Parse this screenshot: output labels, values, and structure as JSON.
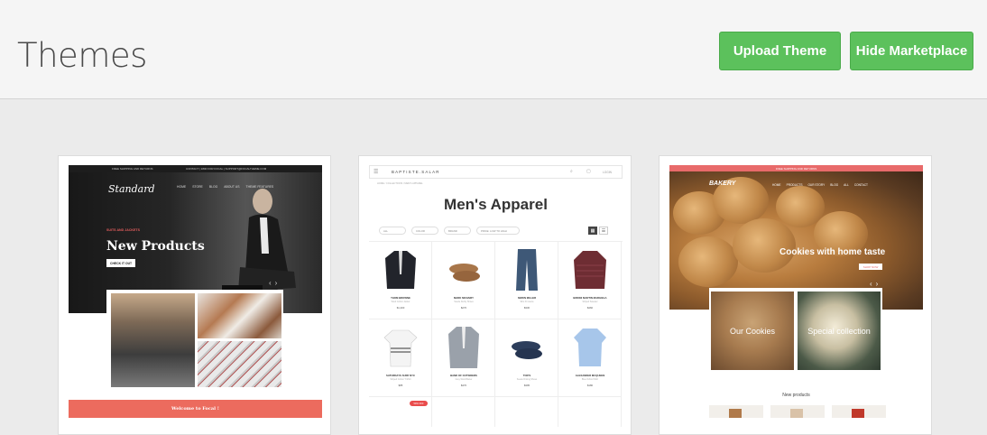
{
  "header": {
    "title": "Themes",
    "upload_button": "Upload Theme",
    "hide_button": "Hide Marketplace",
    "accent": "#5cc15c"
  },
  "themes": [
    {
      "name": "Focal",
      "topbar_left": "FREE SHIPPING AND RETURNS",
      "topbar_right": "CONTACT  |  1800 FOR FOCAL  |  SUPPORT@FOCALTHEME.COM",
      "logo": "Standard",
      "nav": [
        "HOME",
        "STORE",
        "BLOG",
        "ABOUT US",
        "THEME FEATURES"
      ],
      "hero_subtitle": "SUITS AND JACKETS",
      "hero_title": "New Products",
      "hero_button": "CHECK IT OUT",
      "footer_text": "Welcome to Focal !",
      "accent": "#ec6b5e"
    },
    {
      "name": "Baptiste Salar",
      "brand": "BAPTISTE.SALAR",
      "login": "LOGIN",
      "breadcrumb": "HOME / COLLECTIONS / MEN'S APPAREL",
      "title": "Men's Apparel",
      "filters": [
        "ALL",
        "COLOR",
        "BRAND",
        "PRICE: LOW TO HIGH"
      ],
      "products": [
        {
          "name": "THOM BROWNE",
          "sub": "Wool Cotton Jacket",
          "price": "$1,200",
          "color": "#22242b"
        },
        {
          "name": "MARK MCNAIRY",
          "sub": "Suede Derby Shoes",
          "price": "$270",
          "color": "#a8764a"
        },
        {
          "name": "SIMON MILLER",
          "sub": "Slim Fit Jeans",
          "price": "$330",
          "color": "#3e5877"
        },
        {
          "name": "BRIONI MARTIN MARGIELA",
          "sub": "Striped Sweater",
          "price": "$460",
          "color": "#6e2d33"
        },
        {
          "name": "SATURDAYS SURF NYC",
          "sub": "Striped Cotton T-Shirt",
          "price": "$85",
          "color": "#f1f1f1"
        },
        {
          "name": "BAND OF OUTSIDERS",
          "sub": "Grey Wool Blazer",
          "price": "$470",
          "color": "#9aa1aa"
        },
        {
          "name": "TOD'S",
          "sub": "Suede Driving Shoes",
          "price": "$395",
          "color": "#2d3e5c"
        },
        {
          "name": "ALEXANDER MCQUEEN",
          "sub": "Blue Oxford Shirt",
          "price": "$180",
          "color": "#a7c6ea"
        }
      ],
      "sale_badge": "50% OFF"
    },
    {
      "name": "Cookies",
      "topbar": "FREE SHIPPING AND RETURNS",
      "logo": "BAKERY",
      "nav": [
        "HOME",
        "PRODUCTS",
        "OUR STORY",
        "BLOG",
        "ALL",
        "CONTACT"
      ],
      "hero_title": "Cookies with home taste",
      "hero_button": "SHOP NOW",
      "tiles": [
        "Our Cookies",
        "Special collection"
      ],
      "section_title": "New products",
      "accent": "#e86a6a"
    }
  ]
}
